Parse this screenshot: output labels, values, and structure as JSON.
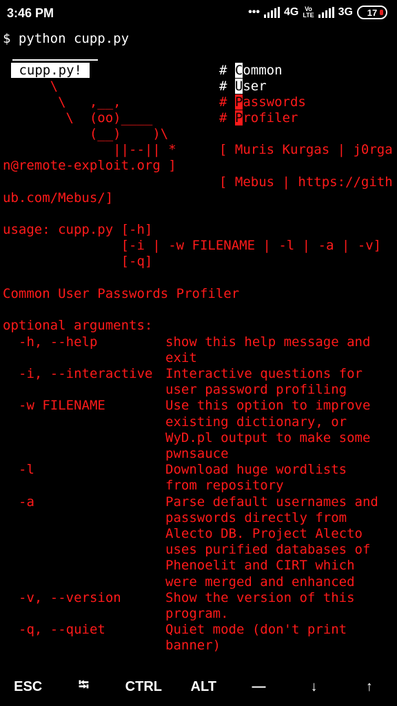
{
  "status_bar": {
    "time": "3:46 PM",
    "dots": "•••",
    "net1": "4G",
    "volte_top": "Vo",
    "volte_bottom": "LTE",
    "net2": "3G",
    "battery": "17"
  },
  "terminal": {
    "prompt": "$ python cupp.py",
    "banner_label": " cupp.py! ",
    "art": [
      "      \\",
      "       \\   ,__,",
      "        \\  (oo)____",
      "           (__)    )\\",
      "              ||--|| *"
    ],
    "tagline": [
      {
        "hash": "# ",
        "cursor": "C",
        "rest": "ommon",
        "style": "white"
      },
      {
        "hash": "# ",
        "cursor": "U",
        "rest": "ser",
        "style": "white"
      },
      {
        "hash": "# ",
        "cursor": "P",
        "rest": "asswords",
        "style": "red"
      },
      {
        "hash": "# ",
        "cursor": "P",
        "rest": "rofiler",
        "style": "red"
      }
    ],
    "credit1_a": "[ Muris Kurgas | j0rga",
    "credit1_b": "n@remote-exploit.org ]",
    "credit2_a": "[ Mebus | https://gith",
    "credit2_b": "ub.com/Mebus/]",
    "usage": [
      "usage: cupp.py [-h]",
      "               [-i | -w FILENAME | -l | -a | -v]",
      "               [-q]"
    ],
    "title": "Common User Passwords Profiler",
    "opt_header": "optional arguments:",
    "options": [
      {
        "flag": "-h, --help",
        "desc": [
          "show this help message and",
          "exit"
        ]
      },
      {
        "flag": "-i, --interactive",
        "desc": [
          "Interactive questions for",
          "user password profiling"
        ]
      },
      {
        "flag": "-w FILENAME",
        "desc": [
          "Use this option to improve",
          "existing dictionary, or",
          "WyD.pl output to make some",
          "pwnsauce"
        ]
      },
      {
        "flag": "-l",
        "desc": [
          "Download huge wordlists",
          "from repository"
        ]
      },
      {
        "flag": "-a",
        "desc": [
          "Parse default usernames and",
          "passwords directly from",
          "Alecto DB. Project Alecto",
          "uses purified databases of",
          "Phenoelit and CIRT which",
          "were merged and enhanced"
        ]
      },
      {
        "flag": "-v, --version",
        "desc": [
          "Show the version of this",
          "program."
        ]
      },
      {
        "flag": "-q, --quiet",
        "desc": [
          "Quiet mode (don't print",
          "banner)"
        ]
      }
    ]
  },
  "keys": [
    {
      "name": "esc-key",
      "label": "ESC"
    },
    {
      "name": "tab-key",
      "label": "⭾"
    },
    {
      "name": "ctrl-key",
      "label": "CTRL"
    },
    {
      "name": "alt-key",
      "label": "ALT"
    },
    {
      "name": "dash-key",
      "label": "—"
    },
    {
      "name": "arrow-down-key",
      "label": "↓"
    },
    {
      "name": "arrow-up-key",
      "label": "↑"
    }
  ]
}
